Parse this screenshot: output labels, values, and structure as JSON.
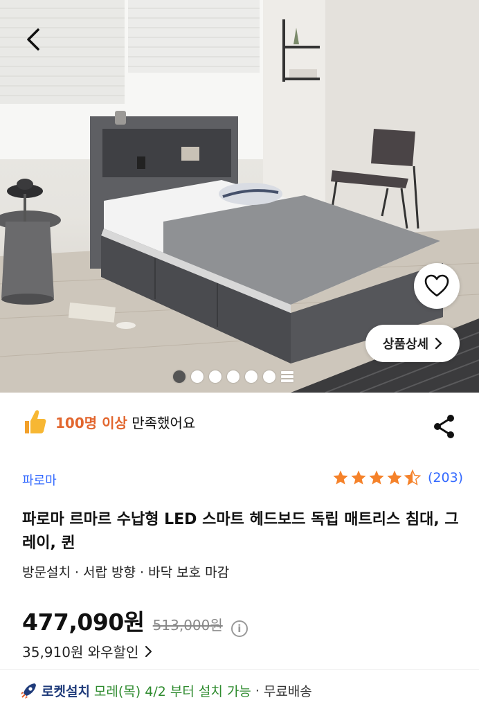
{
  "hero": {
    "image_alt": "Gray storage bed with LED smart headboard in a bright bedroom",
    "detail_button": "상품상세",
    "carousel": {
      "total": 6,
      "active": 1
    }
  },
  "satisfaction": {
    "highlight": "100명 이상",
    "text": "만족했어요"
  },
  "brand": "파로마",
  "rating": {
    "stars": 4.5,
    "count": "(203)"
  },
  "product": {
    "title": "파로마 르마르 수납형 LED 스마트 헤드보드 독립 매트리스 침대, 그레이, 퀸",
    "options": "방문설치 · 서랍 방향 · 바닥 보호 마감"
  },
  "price": {
    "sale": "477,090원",
    "original": "513,000원",
    "wow": "35,910원 와우할인"
  },
  "delivery": {
    "service": "로켓설치",
    "date": "모레(목) 4/2 부터 설치 가능",
    "separator": "·",
    "shipping": "무료배송"
  },
  "colors": {
    "accent_blue": "#346aff",
    "highlight_orange": "#e2662e",
    "star_orange": "#f5822a",
    "delivery_green": "#2e8b2e"
  },
  "icons": [
    "chevron-left-icon",
    "heart-icon",
    "chevron-right-icon",
    "thumbs-up-icon",
    "share-icon",
    "star-icon",
    "info-icon",
    "rocket-icon"
  ]
}
